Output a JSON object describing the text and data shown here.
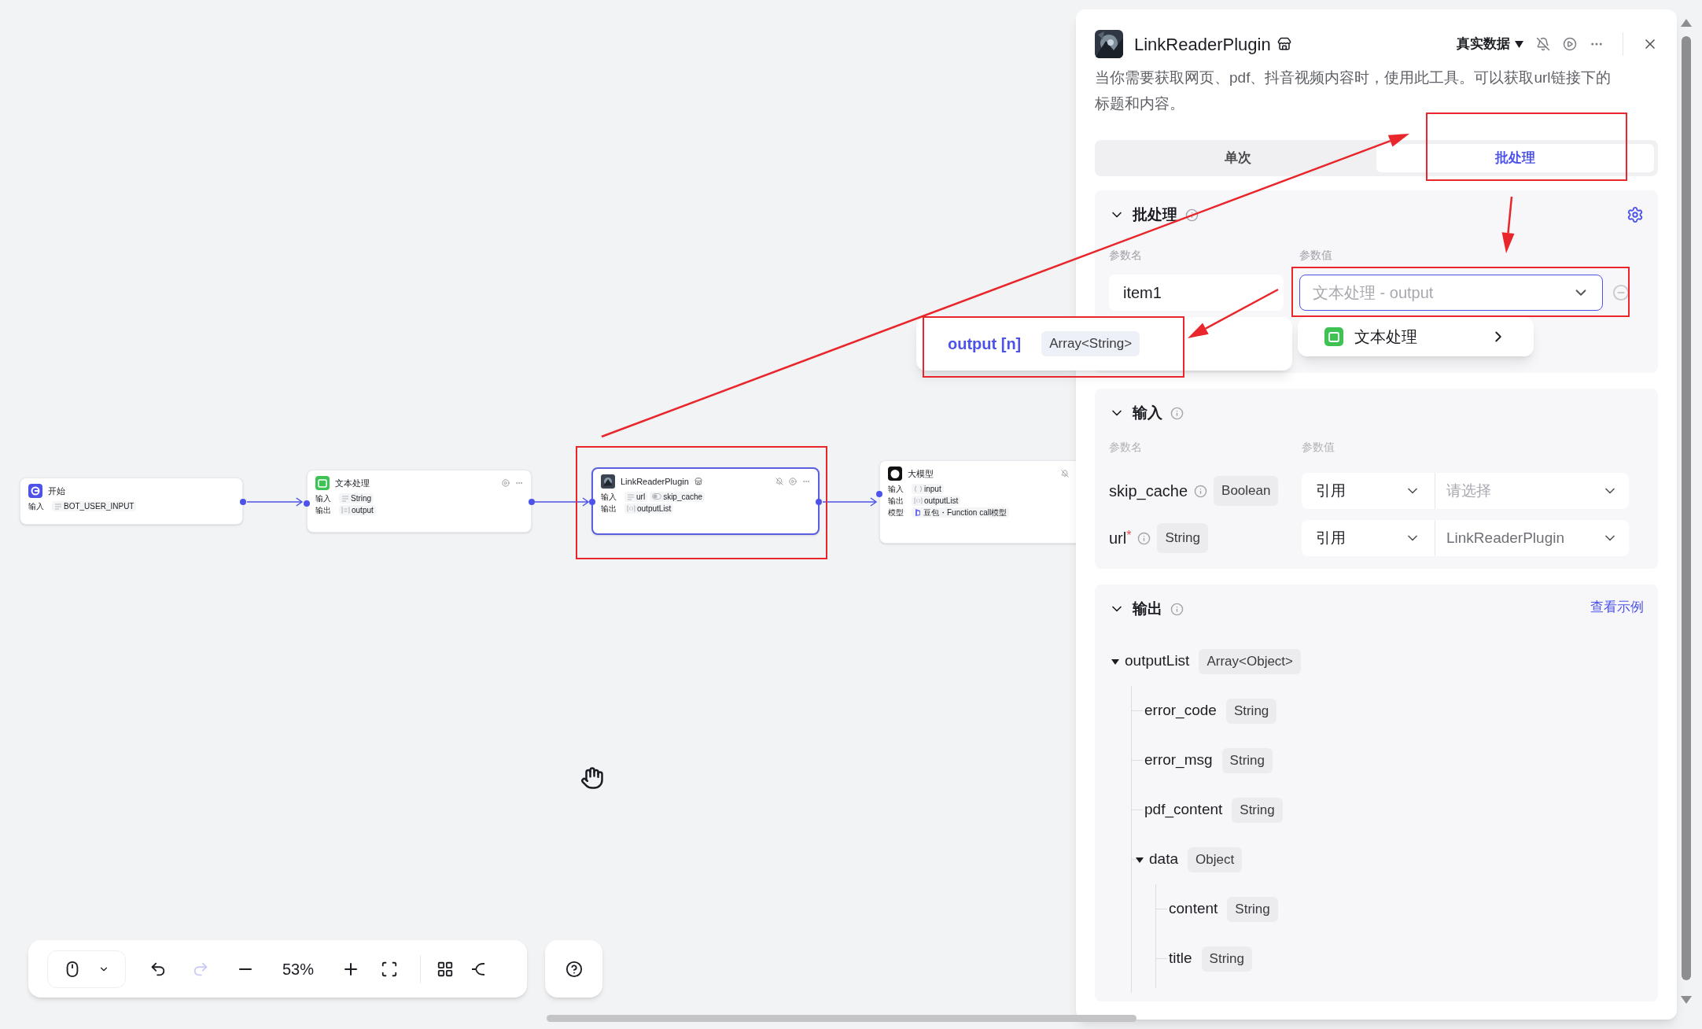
{
  "canvas": {
    "nodes": [
      {
        "kind": "start",
        "title": "开始",
        "selected": false,
        "rows": [
          {
            "label": "输入",
            "params": [
              {
                "kind": "str",
                "name": "BOT_USER_INPUT"
              }
            ]
          }
        ]
      },
      {
        "kind": "text",
        "title": "文本处理",
        "selected": false,
        "rows": [
          {
            "label": "输入",
            "params": [
              {
                "kind": "str",
                "name": "String"
              }
            ]
          },
          {
            "label": "输出",
            "params": [
              {
                "kind": "arr-str",
                "name": "output"
              }
            ]
          }
        ]
      },
      {
        "kind": "plugin",
        "title": "LinkReaderPlugin",
        "selected": true,
        "rows": [
          {
            "label": "输入",
            "params": [
              {
                "kind": "str",
                "name": "url"
              },
              {
                "kind": "bool",
                "name": "skip_cache"
              }
            ]
          },
          {
            "label": "输出",
            "params": [
              {
                "kind": "arr-obj",
                "name": "outputList"
              }
            ]
          }
        ]
      },
      {
        "kind": "llm",
        "title": "大模型",
        "selected": false,
        "rows": [
          {
            "label": "输入",
            "params": [
              {
                "kind": "obj",
                "name": "input"
              }
            ]
          },
          {
            "label": "输出",
            "params": [
              {
                "kind": "arr-obj",
                "name": "outputList"
              }
            ]
          },
          {
            "label": "模型",
            "params": [
              {
                "kind": "model",
                "name": "豆包・Function call模型"
              }
            ]
          }
        ]
      }
    ],
    "toolbar": {
      "zoom": "53%",
      "undo": {
        "disabled": false
      },
      "redo": {
        "disabled": true
      }
    }
  },
  "panel": {
    "title": "LinkReaderPlugin",
    "data_mode": "真实数据",
    "description": "当你需要获取网页、pdf、抖音视频内容时，使用此工具。可以获取url链接下的标题和内容。",
    "mode_tabs": [
      {
        "label": "单次",
        "selected": false
      },
      {
        "label": "批处理",
        "selected": true
      }
    ],
    "batch": {
      "title": "批处理",
      "col_name": "参数名",
      "col_value": "参数值",
      "items": [
        {
          "name": "item1",
          "value": "文本处理 - output"
        }
      ]
    },
    "ref_menu": {
      "node": "文本处理",
      "fields": [
        {
          "name": "output [n]",
          "type": "Array<String>"
        }
      ]
    },
    "input": {
      "title": "输入",
      "col_name": "参数名",
      "col_value": "参数值",
      "params": [
        {
          "name": "skip_cache",
          "type": "Boolean",
          "mode": "引用",
          "placeholder": "请选择"
        },
        {
          "name": "url",
          "mark": "*",
          "type": "String",
          "mode": "引用",
          "value": "LinkReaderPlugin"
        }
      ]
    },
    "output": {
      "title": "输出",
      "link": "查看示例",
      "tree": [
        {
          "name": "outputList",
          "type": "Array<Object>",
          "expanded": true,
          "children": [
            {
              "name": "error_code",
              "type": "String"
            },
            {
              "name": "error_msg",
              "type": "String"
            },
            {
              "name": "pdf_content",
              "type": "String"
            },
            {
              "name": "data",
              "type": "Object",
              "expanded": true,
              "children": [
                {
                  "name": "content",
                  "type": "String"
                },
                {
                  "name": "title",
                  "type": "String"
                }
              ]
            }
          ]
        }
      ]
    }
  }
}
